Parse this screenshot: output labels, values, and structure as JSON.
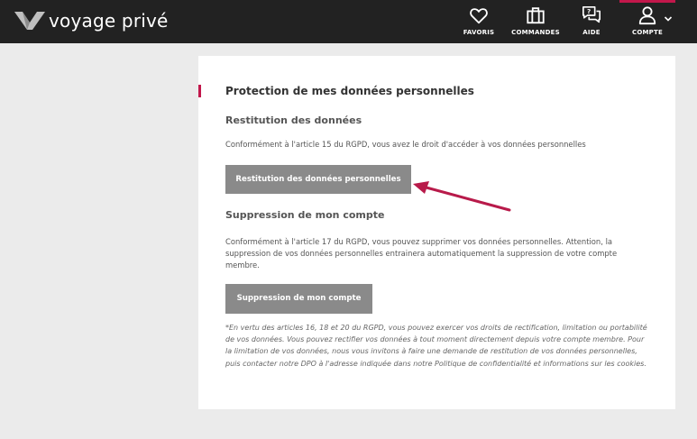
{
  "header": {
    "logo_text_bold": "voyage",
    "logo_text_light": " privé",
    "nav": {
      "favoris": "FAVORIS",
      "commandes": "COMMANDES",
      "aide": "AIDE",
      "compte": "COMPTE"
    }
  },
  "section": {
    "title": "Protection de mes données personnelles",
    "restitution": {
      "heading": "Restitution des données",
      "text": "Conformément à l'article 15 du RGPD, vous avez le droit d'accéder à vos données personnelles",
      "button": "Restitution des données personnelles"
    },
    "suppression": {
      "heading": "Suppression de mon compte",
      "text": "Conformément à l'article 17 du RGPD, vous pouvez supprimer vos données personnelles. Attention, la suppression de vos données personnelles entrainera automatiquement la suppression de votre compte membre.",
      "button": "Suppression de mon compte"
    },
    "note": "*En vertu des articles 16, 18 et 20 du RGPD, vous pouvez exercer vos droits de rectification, limitation ou portabilité de vos données. Vous pouvez rectifier vos données à tout moment directement depuis votre compte membre. Pour la limitation de vos données, nous vous invitons à faire une demande de restitution de vos données personnelles, puis contacter notre DPO à l'adresse indiquée dans notre Politique de confidentialité et informations sur les cookies."
  },
  "colors": {
    "accent": "#c2174b",
    "topbar": "#222222",
    "button": "#8a8a8a"
  }
}
